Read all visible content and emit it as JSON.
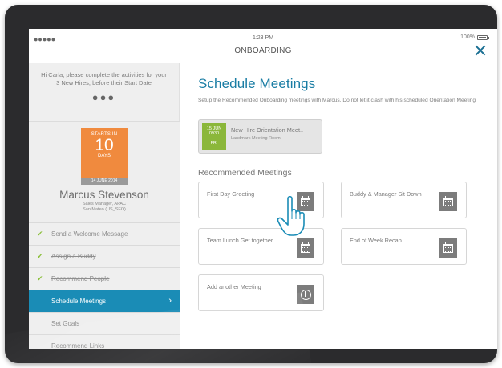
{
  "status_bar": {
    "signal": "●●●●●",
    "time": "1:23 PM",
    "battery": "100%"
  },
  "header": {
    "title": "ONBOARDING",
    "close_icon": "close-icon"
  },
  "sidebar": {
    "intro_text": "Hi Carla, please complete the activities for your 3 New Hires, before their Start Date",
    "more_dots": "●●●",
    "countdown": {
      "label": "STARTS IN",
      "number": "10",
      "unit": "DAYS",
      "date": "14 JUNE 2014"
    },
    "person": {
      "name": "Marcus Stevenson",
      "role": "Sales Manager, APAC",
      "location": "San Mateo (US_SFO)"
    },
    "tasks": [
      {
        "label": "Send a Welcome Message",
        "state": "done"
      },
      {
        "label": "Assign a Buddy",
        "state": "done"
      },
      {
        "label": "Recommend People",
        "state": "done"
      },
      {
        "label": "Schedule Meetings",
        "state": "active"
      },
      {
        "label": "Set Goals",
        "state": "todo"
      },
      {
        "label": "Recommend Links",
        "state": "todo"
      }
    ],
    "check_icon": "✔",
    "chevron_icon": "›"
  },
  "main": {
    "title": "Schedule Meetings",
    "description": "Setup the Recommended Onboarding meetings with Marcus. Do not let it clash with his scheduled Orientation Meeting",
    "scheduled_meeting": {
      "date_day": "15 JUN",
      "date_time": "0930",
      "weekday": "FRI",
      "title": "New Hire Orientation Meet..",
      "location": "Landmark Meeting Room",
      "accent_color": "#8bb73a"
    },
    "recommended_title": "Recommended Meetings",
    "meetings": [
      {
        "label": "First  Day Greeting",
        "icon": "calendar-icon"
      },
      {
        "label": "Buddy & Manager Sit Down",
        "icon": "calendar-icon"
      },
      {
        "label": "Team Lunch Get together",
        "icon": "calendar-icon"
      },
      {
        "label": "End of Week Recap",
        "icon": "calendar-icon"
      },
      {
        "label": "Add another Meeting",
        "icon": "plus-circle-icon"
      }
    ]
  },
  "colors": {
    "accent_blue": "#1a8cb6",
    "title_blue": "#1a7da4",
    "countdown_orange": "#f08a3e",
    "check_green": "#8bbf3a",
    "tablet_frame": "#2b2b2d"
  }
}
